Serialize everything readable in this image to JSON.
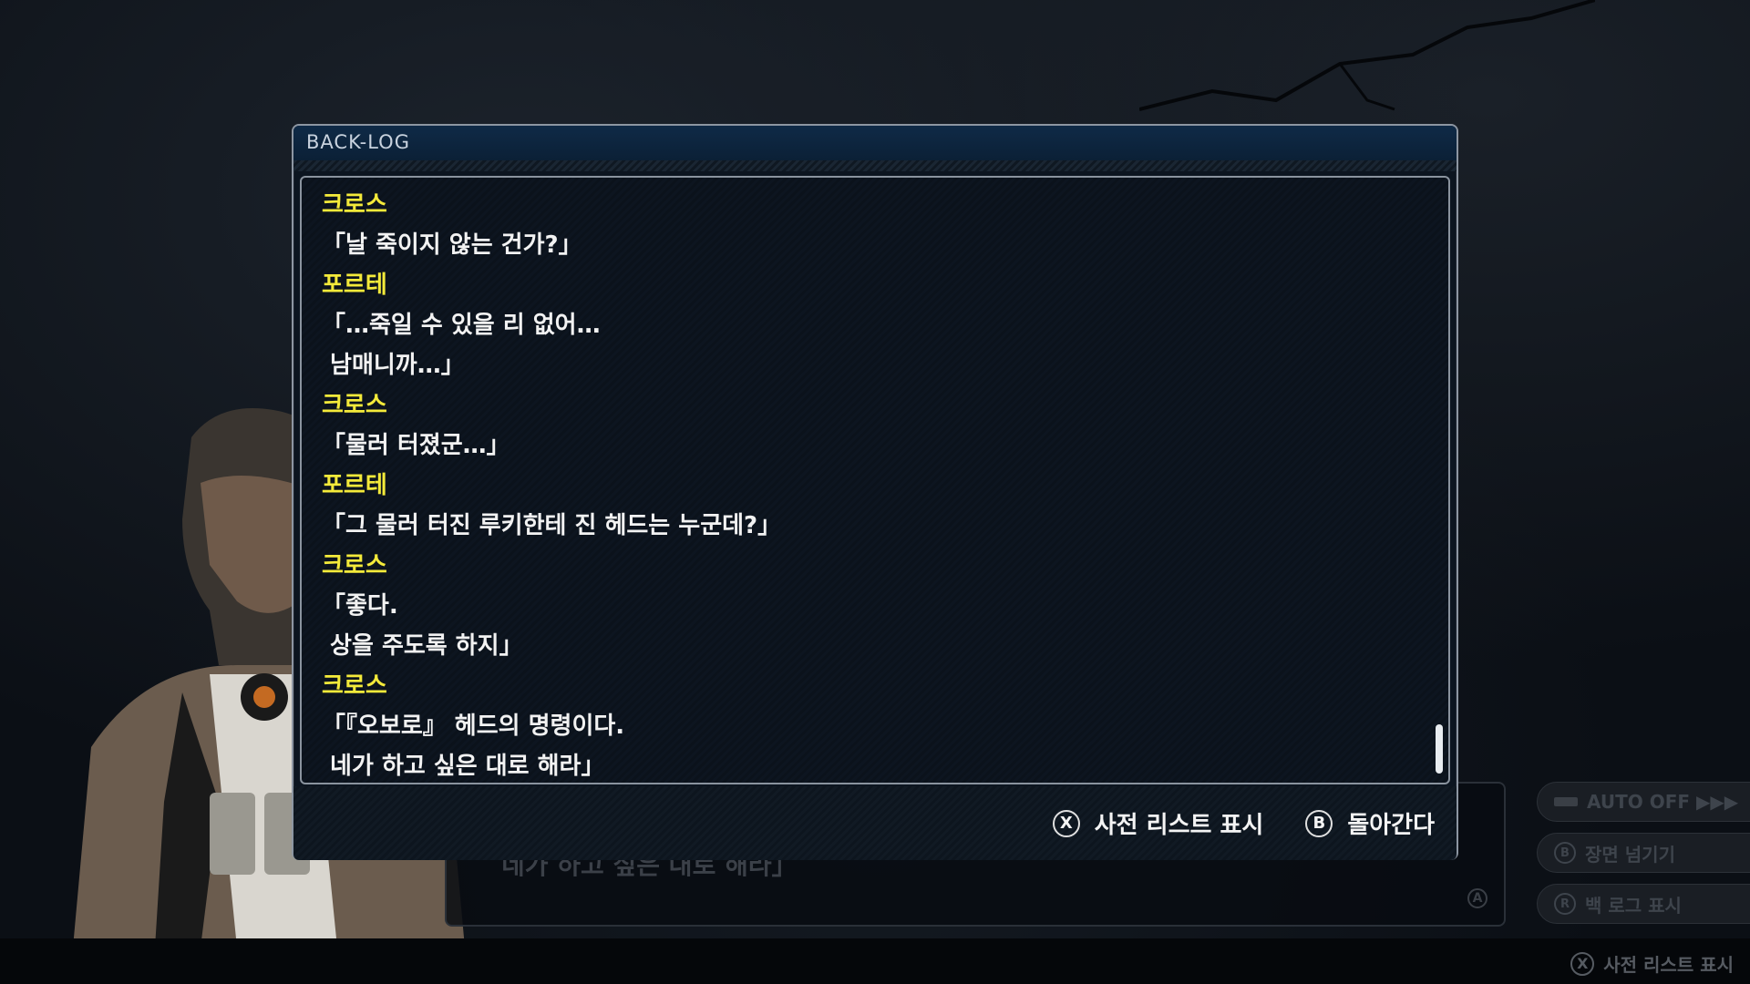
{
  "panel": {
    "title": "BACK-LOG"
  },
  "log": [
    {
      "type": "speaker",
      "text": "크로스"
    },
    {
      "type": "speech",
      "text": "「날 죽이지 않는 건가?」"
    },
    {
      "type": "speaker",
      "text": "포르테"
    },
    {
      "type": "speech",
      "text": "「…죽일 수 있을 리 없어…"
    },
    {
      "type": "speech",
      "text": " 남매니까…」"
    },
    {
      "type": "speaker",
      "text": "크로스"
    },
    {
      "type": "speech",
      "text": "「물러 터졌군…」"
    },
    {
      "type": "speaker",
      "text": "포르테"
    },
    {
      "type": "speech",
      "text": "「그 물러 터진 루키한테 진 헤드는 누군데?」"
    },
    {
      "type": "speaker",
      "text": "크로스"
    },
    {
      "type": "speech",
      "text": "「좋다."
    },
    {
      "type": "speech",
      "text": " 상을 주도록 하지」"
    },
    {
      "type": "speaker",
      "text": "크로스"
    },
    {
      "type": "speech",
      "text": "「『오보로』 헤드의 명령이다."
    },
    {
      "type": "speech",
      "text": " 네가 하고 싶은 대로 해라」"
    }
  ],
  "footer": {
    "dictionary_button": "X",
    "dictionary_label": "사전 리스트 표시",
    "back_button": "B",
    "back_label": "돌아간다"
  },
  "side_menu": {
    "auto_label": "AUTO OFF ▶▶▶",
    "skip_button": "B",
    "skip_label": "장면 넘기기",
    "backlog_button": "R",
    "backlog_label": "백 로그 표시"
  },
  "under_dialogue": {
    "text": "네가 하고 싶은 대로 해라」",
    "advance_button": "A"
  },
  "bottom_hint": {
    "button": "X",
    "label": "사전 리스트 표시"
  },
  "colors": {
    "speaker": "#f4ea3a",
    "speech": "#f2f2f2",
    "header": "#0f2a47"
  }
}
